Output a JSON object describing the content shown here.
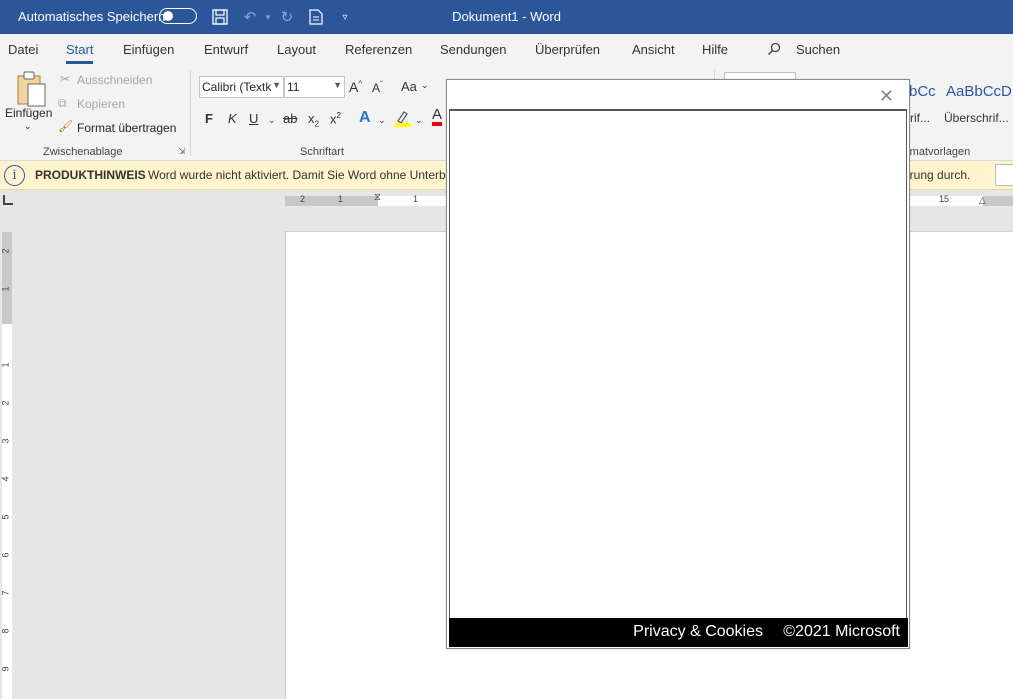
{
  "titlebar": {
    "autosave_label": "Automatisches Speichern",
    "document_title": "Dokument1  -  Word"
  },
  "menu": {
    "tabs": [
      "Datei",
      "Start",
      "Einfügen",
      "Entwurf",
      "Layout",
      "Referenzen",
      "Sendungen",
      "Überprüfen",
      "Ansicht",
      "Hilfe"
    ],
    "active_tab": "Start",
    "search_label": "Suchen"
  },
  "ribbon": {
    "clipboard": {
      "paste_label": "Einfügen",
      "cut_label": "Ausschneiden",
      "copy_label": "Kopieren",
      "format_painter_label": "Format übertragen",
      "group_label": "Zwischenablage"
    },
    "font": {
      "font_name": "Calibri (Textk",
      "font_size": "11",
      "case_label": "Aa",
      "bold": "F",
      "italic": "K",
      "underline": "U",
      "strike": "ab",
      "subscript": "x",
      "superscript": "x",
      "group_label": "Schriftart"
    },
    "styles": {
      "preview_1": "bCc",
      "preview_2": "AaBbCcD",
      "name_1": "rif...",
      "name_2": "Überschrif...",
      "group_label": "rmatvorlagen"
    }
  },
  "notice": {
    "label": "PRODUKTHINWEIS",
    "message": "Word wurde nicht aktiviert. Damit Sie Word ohne Unterb",
    "message_end": "erung durch."
  },
  "ruler": {
    "h_numbers": [
      "2",
      "1",
      "1",
      "15"
    ],
    "v_numbers": [
      "2",
      "1",
      "1",
      "2",
      "3",
      "4",
      "5",
      "6",
      "7",
      "8",
      "9"
    ]
  },
  "dialog": {
    "privacy_link": "Privacy & Cookies",
    "copyright": "©2021 Microsoft"
  },
  "colors": {
    "word_blue": "#2b579a",
    "ribbon_bg": "#f3f3f3",
    "notice_bg": "#fff4ce"
  }
}
